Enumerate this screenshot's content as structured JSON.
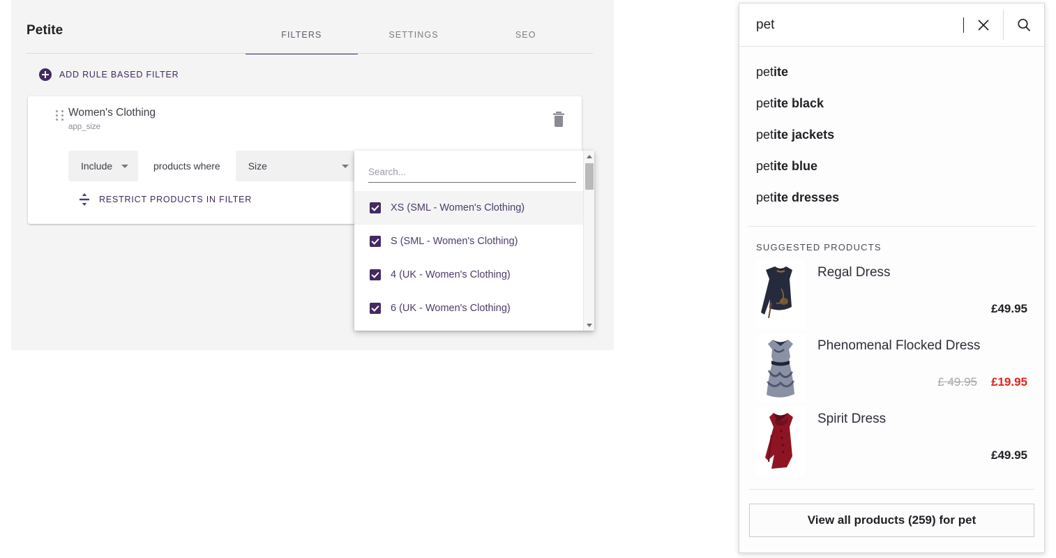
{
  "editor": {
    "page_title": "Petite",
    "tabs": [
      {
        "label": "FILTERS",
        "active": true
      },
      {
        "label": "SETTINGS",
        "active": false
      },
      {
        "label": "SEO",
        "active": false
      }
    ],
    "add_rule_label": "ADD RULE BASED FILTER",
    "rule": {
      "title": "Women's Clothing",
      "subtitle": "app_size",
      "include_value": "Include",
      "middle_text": "products where",
      "attribute_value": "Size",
      "restrict_label": "RESTRICT PRODUCTS IN FILTER",
      "delete_icon": "trash-icon",
      "drag_icon": "drag-handle-icon"
    },
    "dropdown": {
      "search_placeholder": "Search...",
      "search_value": "",
      "options": [
        {
          "label": "XS (SML - Women's Clothing)",
          "checked": true,
          "highlighted": true
        },
        {
          "label": "S (SML - Women's Clothing)",
          "checked": true,
          "highlighted": false
        },
        {
          "label": "4 (UK - Women's Clothing)",
          "checked": true,
          "highlighted": false
        },
        {
          "label": "6 (UK - Women's Clothing)",
          "checked": true,
          "highlighted": false
        }
      ]
    }
  },
  "search": {
    "query": "pet",
    "prefix": "pet",
    "clear_icon": "close-icon",
    "submit_icon": "search-icon",
    "suggestions": [
      {
        "prefix": "pet",
        "rest": "ite"
      },
      {
        "prefix": "pet",
        "rest": "ite black"
      },
      {
        "prefix": "pet",
        "rest": "ite jackets"
      },
      {
        "prefix": "pet",
        "rest": "ite blue"
      },
      {
        "prefix": "pet",
        "rest": "ite dresses"
      }
    ],
    "products_heading": "SUGGESTED PRODUCTS",
    "products": [
      {
        "name": "Regal Dress",
        "price": "£49.95",
        "old_price": "",
        "sale_price": ""
      },
      {
        "name": "Phenomenal Flocked Dress",
        "price": "",
        "old_price": "£ 49.95",
        "sale_price": "£19.95"
      },
      {
        "name": "Spirit Dress",
        "price": "£49.95",
        "old_price": "",
        "sale_price": ""
      }
    ],
    "view_all_label": "View all products (259) for pet"
  },
  "colors": {
    "accent_purple": "#432a63",
    "sale_red": "#e32119",
    "panel_gray": "#f4f4f4"
  }
}
